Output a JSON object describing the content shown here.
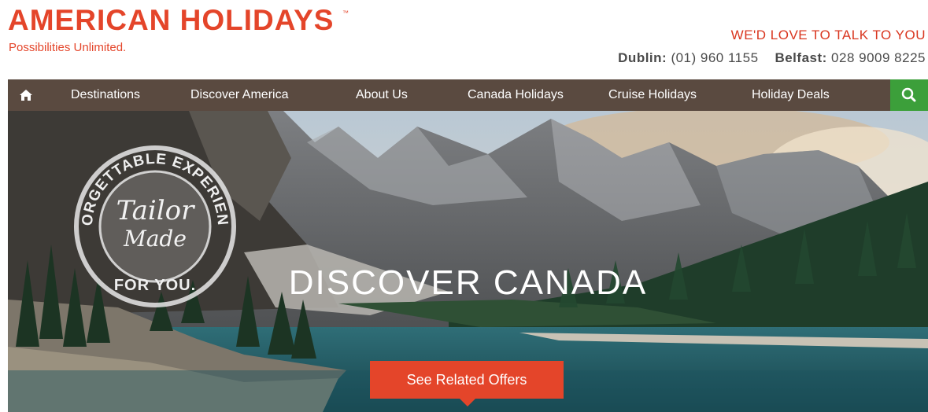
{
  "brand": {
    "logo_text": "AMERICAN HOLIDAYS",
    "trademark": "™",
    "tagline": "Possibilities Unlimited."
  },
  "contact": {
    "heading": "WE'D LOVE TO TALK TO YOU",
    "dublin_label": "Dublin:",
    "dublin_number": "(01) 960 1155",
    "belfast_label": "Belfast:",
    "belfast_number": "028 9009 8225"
  },
  "nav": {
    "items": [
      {
        "label": "Destinations"
      },
      {
        "label": "Discover America"
      },
      {
        "label": "About Us"
      },
      {
        "label": "Canada Holidays"
      },
      {
        "label": "Cruise Holidays"
      },
      {
        "label": "Holiday Deals"
      }
    ],
    "home_icon": "home-icon",
    "search_icon": "search-icon"
  },
  "hero": {
    "title": "DISCOVER CANADA",
    "cta_label": "See Related Offers",
    "stamp": {
      "top_text": "UNFORGETTABLE EXPERIENCES",
      "line1": "Tailor",
      "line2": "Made",
      "bottom_text": "FOR YOU."
    }
  },
  "colors": {
    "brand_red": "#e4452a",
    "nav_bg": "#5a4a40",
    "search_green": "#3c9f3a"
  }
}
